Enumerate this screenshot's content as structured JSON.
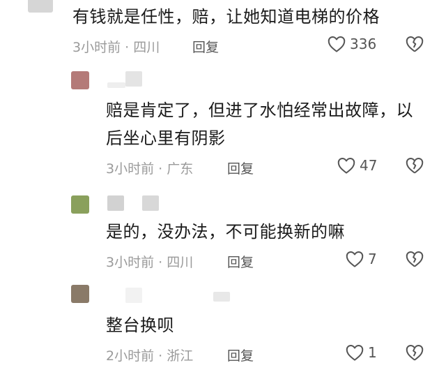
{
  "comments": [
    {
      "text": "有钱就是任性，赔，让她知道电梯的价格",
      "time": "3小时前",
      "location": "四川",
      "reply": "回复",
      "likes": "336"
    },
    {
      "text_line1": "赔是肯定了，但进了水怕经常出故障，以",
      "text_line2": "后坐心里有阴影",
      "time": "3小时前",
      "location": "广东",
      "reply": "回复",
      "likes": "47",
      "avatar_color": "#b47a78"
    },
    {
      "text": "是的，没办法，不可能换新的嘛",
      "time": "3小时前",
      "location": "四川",
      "reply": "回复",
      "likes": "7",
      "avatar_color": "#8aa05c"
    },
    {
      "text": "整台换呗",
      "time": "2小时前",
      "location": "浙江",
      "reply": "回复",
      "likes": "1",
      "avatar_color": "#8a7a68"
    }
  ],
  "separator": " · ",
  "icons": {
    "like": "heart-outline-icon",
    "dislike": "broken-heart-icon"
  }
}
